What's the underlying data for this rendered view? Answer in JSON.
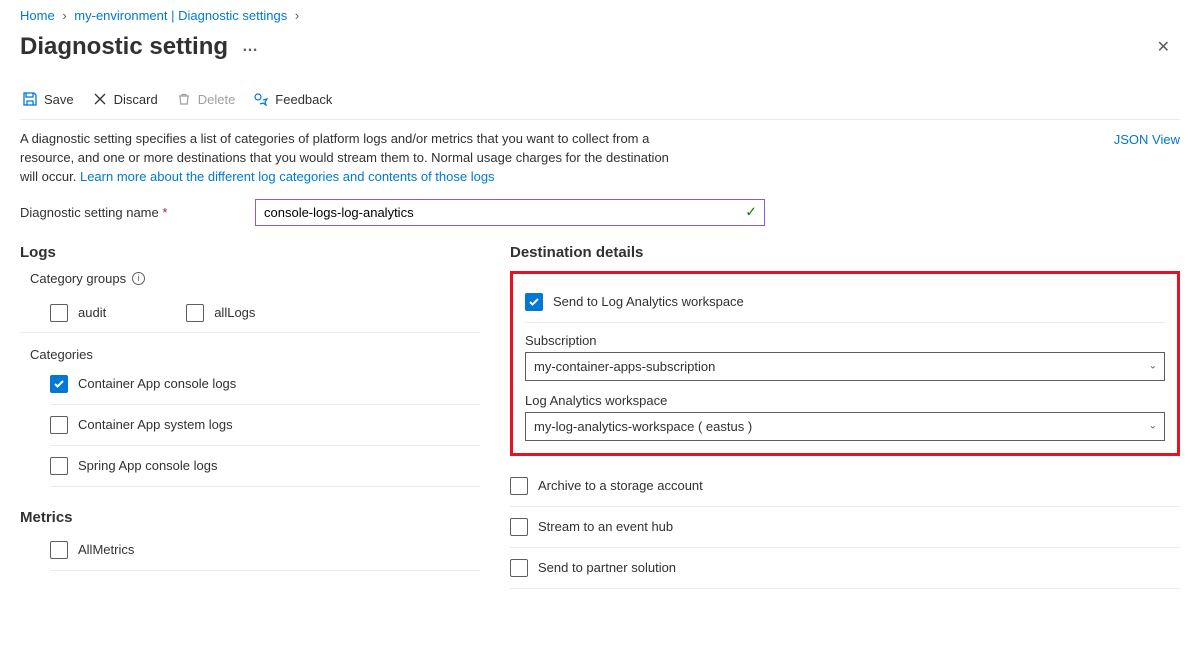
{
  "breadcrumb": {
    "home": "Home",
    "env": "my-environment | Diagnostic settings"
  },
  "page": {
    "title": "Diagnostic setting"
  },
  "toolbar": {
    "save": "Save",
    "discard": "Discard",
    "delete": "Delete",
    "feedback": "Feedback"
  },
  "description": {
    "text": "A diagnostic setting specifies a list of categories of platform logs and/or metrics that you want to collect from a resource, and one or more destinations that you would stream them to. Normal usage charges for the destination will occur. ",
    "link": "Learn more about the different log categories and contents of those logs"
  },
  "json_view": "JSON View",
  "name_field": {
    "label": "Diagnostic setting name",
    "value": "console-logs-log-analytics"
  },
  "logs": {
    "title": "Logs",
    "category_groups_label": "Category groups",
    "groups": [
      {
        "label": "audit",
        "checked": false
      },
      {
        "label": "allLogs",
        "checked": false
      }
    ],
    "categories_label": "Categories",
    "categories": [
      {
        "label": "Container App console logs",
        "checked": true
      },
      {
        "label": "Container App system logs",
        "checked": false
      },
      {
        "label": "Spring App console logs",
        "checked": false
      }
    ]
  },
  "metrics": {
    "title": "Metrics",
    "items": [
      {
        "label": "AllMetrics",
        "checked": false
      }
    ]
  },
  "destinations": {
    "title": "Destination details",
    "log_analytics": {
      "label": "Send to Log Analytics workspace",
      "checked": true,
      "subscription_label": "Subscription",
      "subscription_value": "my-container-apps-subscription",
      "workspace_label": "Log Analytics workspace",
      "workspace_value": "my-log-analytics-workspace ( eastus )"
    },
    "others": [
      {
        "label": "Archive to a storage account",
        "checked": false
      },
      {
        "label": "Stream to an event hub",
        "checked": false
      },
      {
        "label": "Send to partner solution",
        "checked": false
      }
    ]
  }
}
